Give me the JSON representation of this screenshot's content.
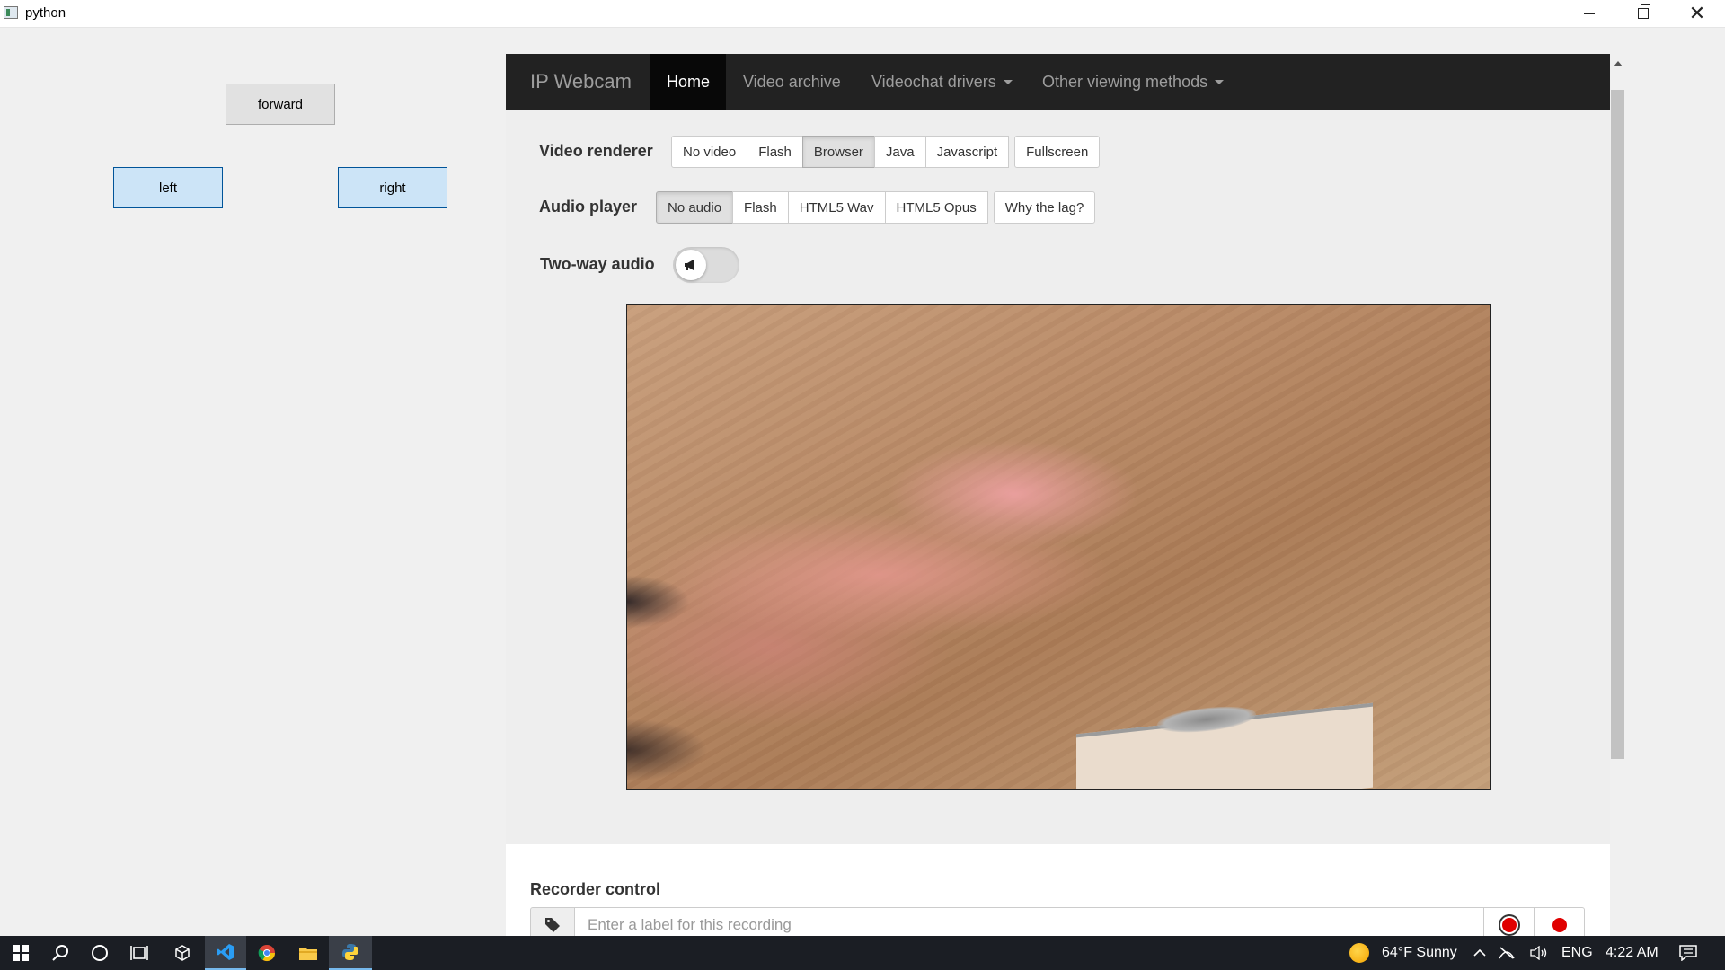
{
  "window": {
    "title": "python"
  },
  "controls": {
    "forward": "forward",
    "left": "left",
    "right": "right"
  },
  "browser": {
    "brand": "IP Webcam",
    "nav": [
      "Home",
      "Video archive",
      "Videochat drivers",
      "Other viewing methods"
    ],
    "video_renderer": {
      "label": "Video renderer",
      "options": [
        "No video",
        "Flash",
        "Browser",
        "Java",
        "Javascript"
      ],
      "selected": "Browser",
      "fullscreen": "Fullscreen"
    },
    "audio_player": {
      "label": "Audio player",
      "options": [
        "No audio",
        "Flash",
        "HTML5 Wav",
        "HTML5 Opus"
      ],
      "selected": "No audio",
      "why_lag": "Why the lag?"
    },
    "two_way_audio": {
      "label": "Two-way audio",
      "enabled": false
    },
    "recorder": {
      "title": "Recorder control",
      "placeholder": "Enter a label for this recording"
    }
  },
  "taskbar": {
    "weather": "64°F  Sunny",
    "language": "ENG",
    "time": "4:22 AM"
  }
}
